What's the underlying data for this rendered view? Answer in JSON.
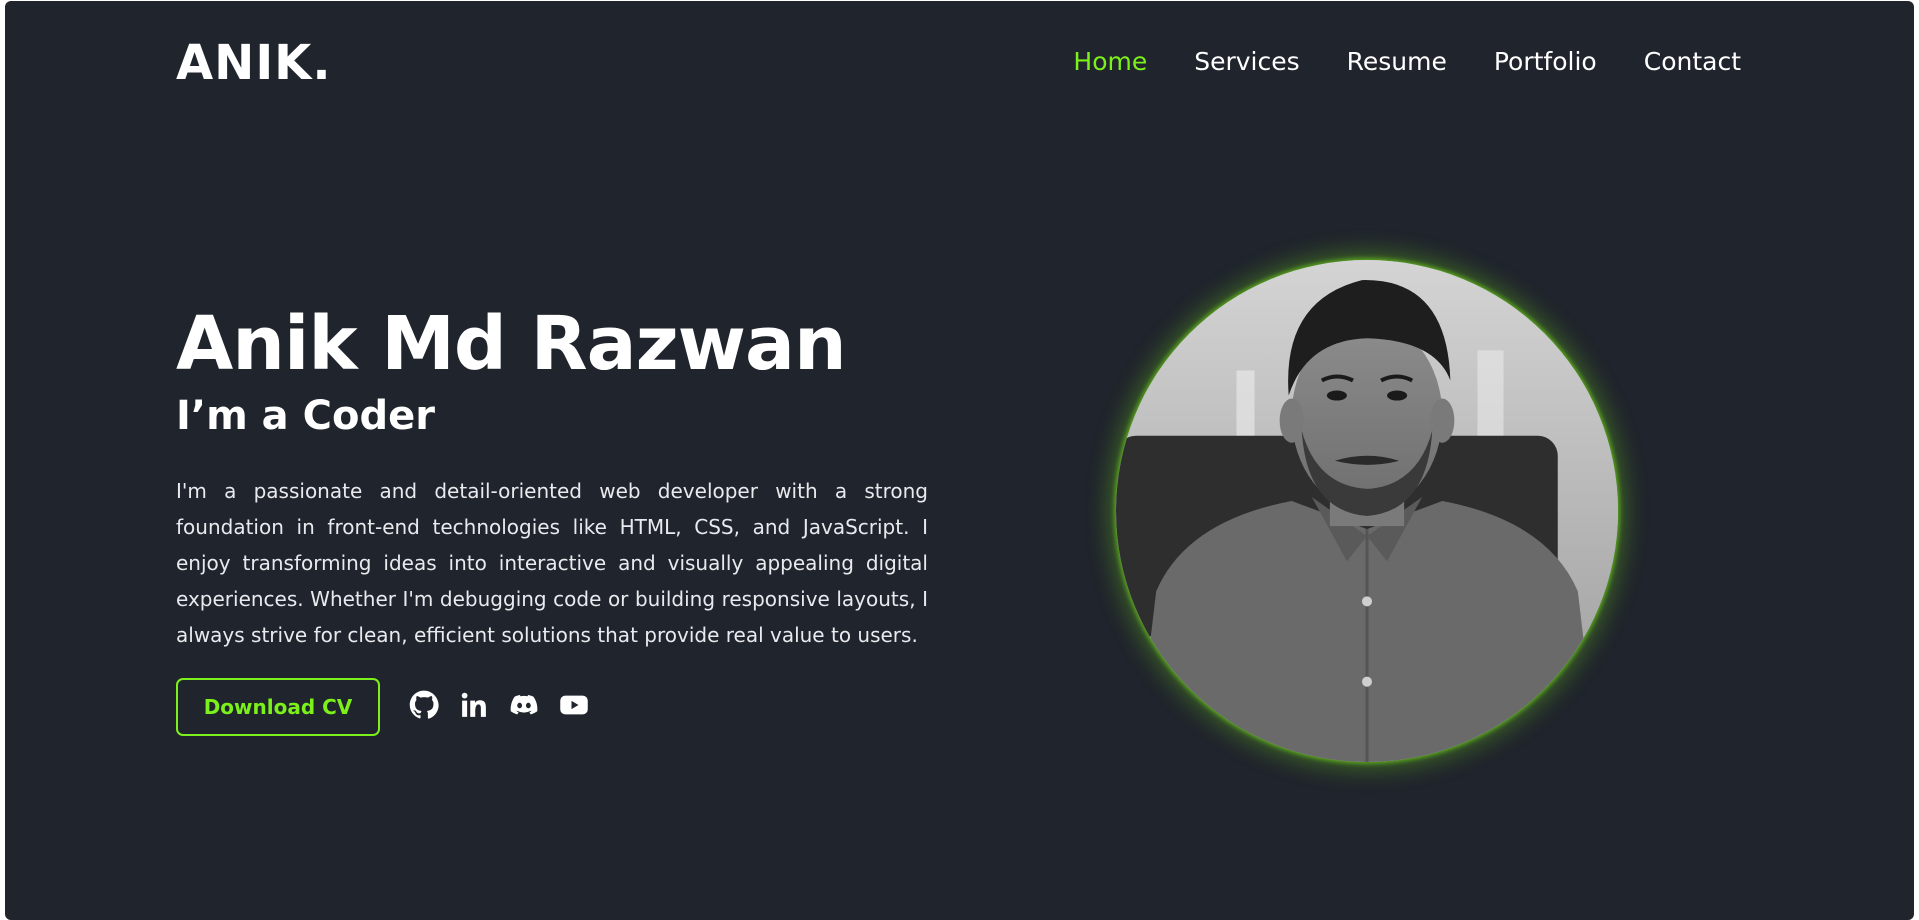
{
  "brand": {
    "logo": "ANIK."
  },
  "nav": {
    "items": [
      {
        "label": "Home",
        "active": true
      },
      {
        "label": "Services",
        "active": false
      },
      {
        "label": "Resume",
        "active": false
      },
      {
        "label": "Portfolio",
        "active": false
      },
      {
        "label": "Contact",
        "active": false
      }
    ]
  },
  "hero": {
    "name": "Anik Md Razwan",
    "role": "I’m a Coder",
    "description": "I'm a passionate and detail-oriented web developer with a strong foundation in front-end technologies like HTML, CSS, and JavaScript. I enjoy transforming ideas into interactive and visually appealing digital experiences. Whether I'm debugging code or building responsive layouts, I always strive for clean, efficient solutions that provide real value to users.",
    "cta_label": "Download CV"
  },
  "socials": [
    {
      "icon": "github-icon"
    },
    {
      "icon": "linkedin-icon"
    },
    {
      "icon": "discord-icon"
    },
    {
      "icon": "youtube-icon"
    }
  ],
  "colors": {
    "background": "#20242c",
    "accent": "#7cf01a",
    "text": "#ffffff"
  }
}
